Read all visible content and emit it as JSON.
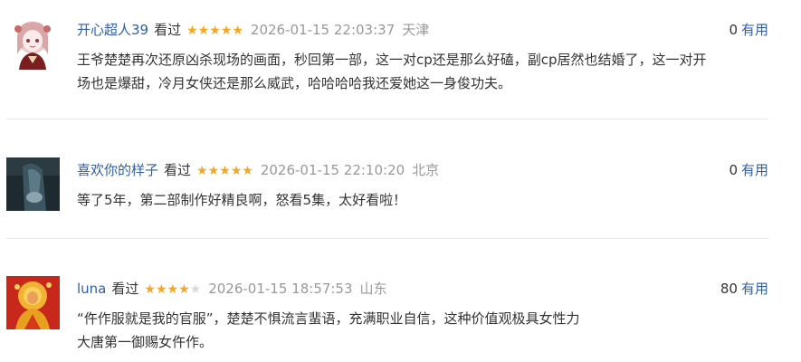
{
  "comments": [
    {
      "username": "开心超人39",
      "watched_label": "看过",
      "rating_stars": 5,
      "rating_max": 5,
      "timestamp": "2026-01-15 22:03:37",
      "location": "天津",
      "useful_count": "0",
      "useful_label": "有用",
      "content_line1": "王爷楚楚再次还原凶杀现场的画面，秒回第一部，这一对cp还是那么好磕，副cp居然也结婚了，这一对开",
      "content_line2": "场也是爆甜，冷月女侠还是那么威武，哈哈哈哈我还爱她这一身俊功夫。",
      "avatar_desc": "anime-girl-avatar"
    },
    {
      "username": "喜欢你的样子",
      "watched_label": "看过",
      "rating_stars": 5,
      "rating_max": 5,
      "timestamp": "2026-01-15 22:10:20",
      "location": "北京",
      "useful_count": "0",
      "useful_label": "有用",
      "content_line1": "等了5年，第二部制作好精良啊，怒看5集，太好看啦！",
      "avatar_desc": "dark-photo-avatar"
    },
    {
      "username": "luna",
      "watched_label": "看过",
      "rating_stars": 4,
      "rating_max": 5,
      "timestamp": "2026-01-15 18:57:53",
      "location": "山东",
      "useful_count": "80",
      "useful_label": "有用",
      "content_line1": "“仵作服就是我的官服”，楚楚不惧流言蜚语，充满职业自信，这种价值观极具女性力",
      "content_line2": "大唐第一御赐女仵作。",
      "avatar_desc": "golden-figure-avatar"
    }
  ],
  "colors": {
    "link": "#2f5fa7",
    "star": "#f6a623",
    "meta": "#999999",
    "divider": "#e8e8e8"
  }
}
